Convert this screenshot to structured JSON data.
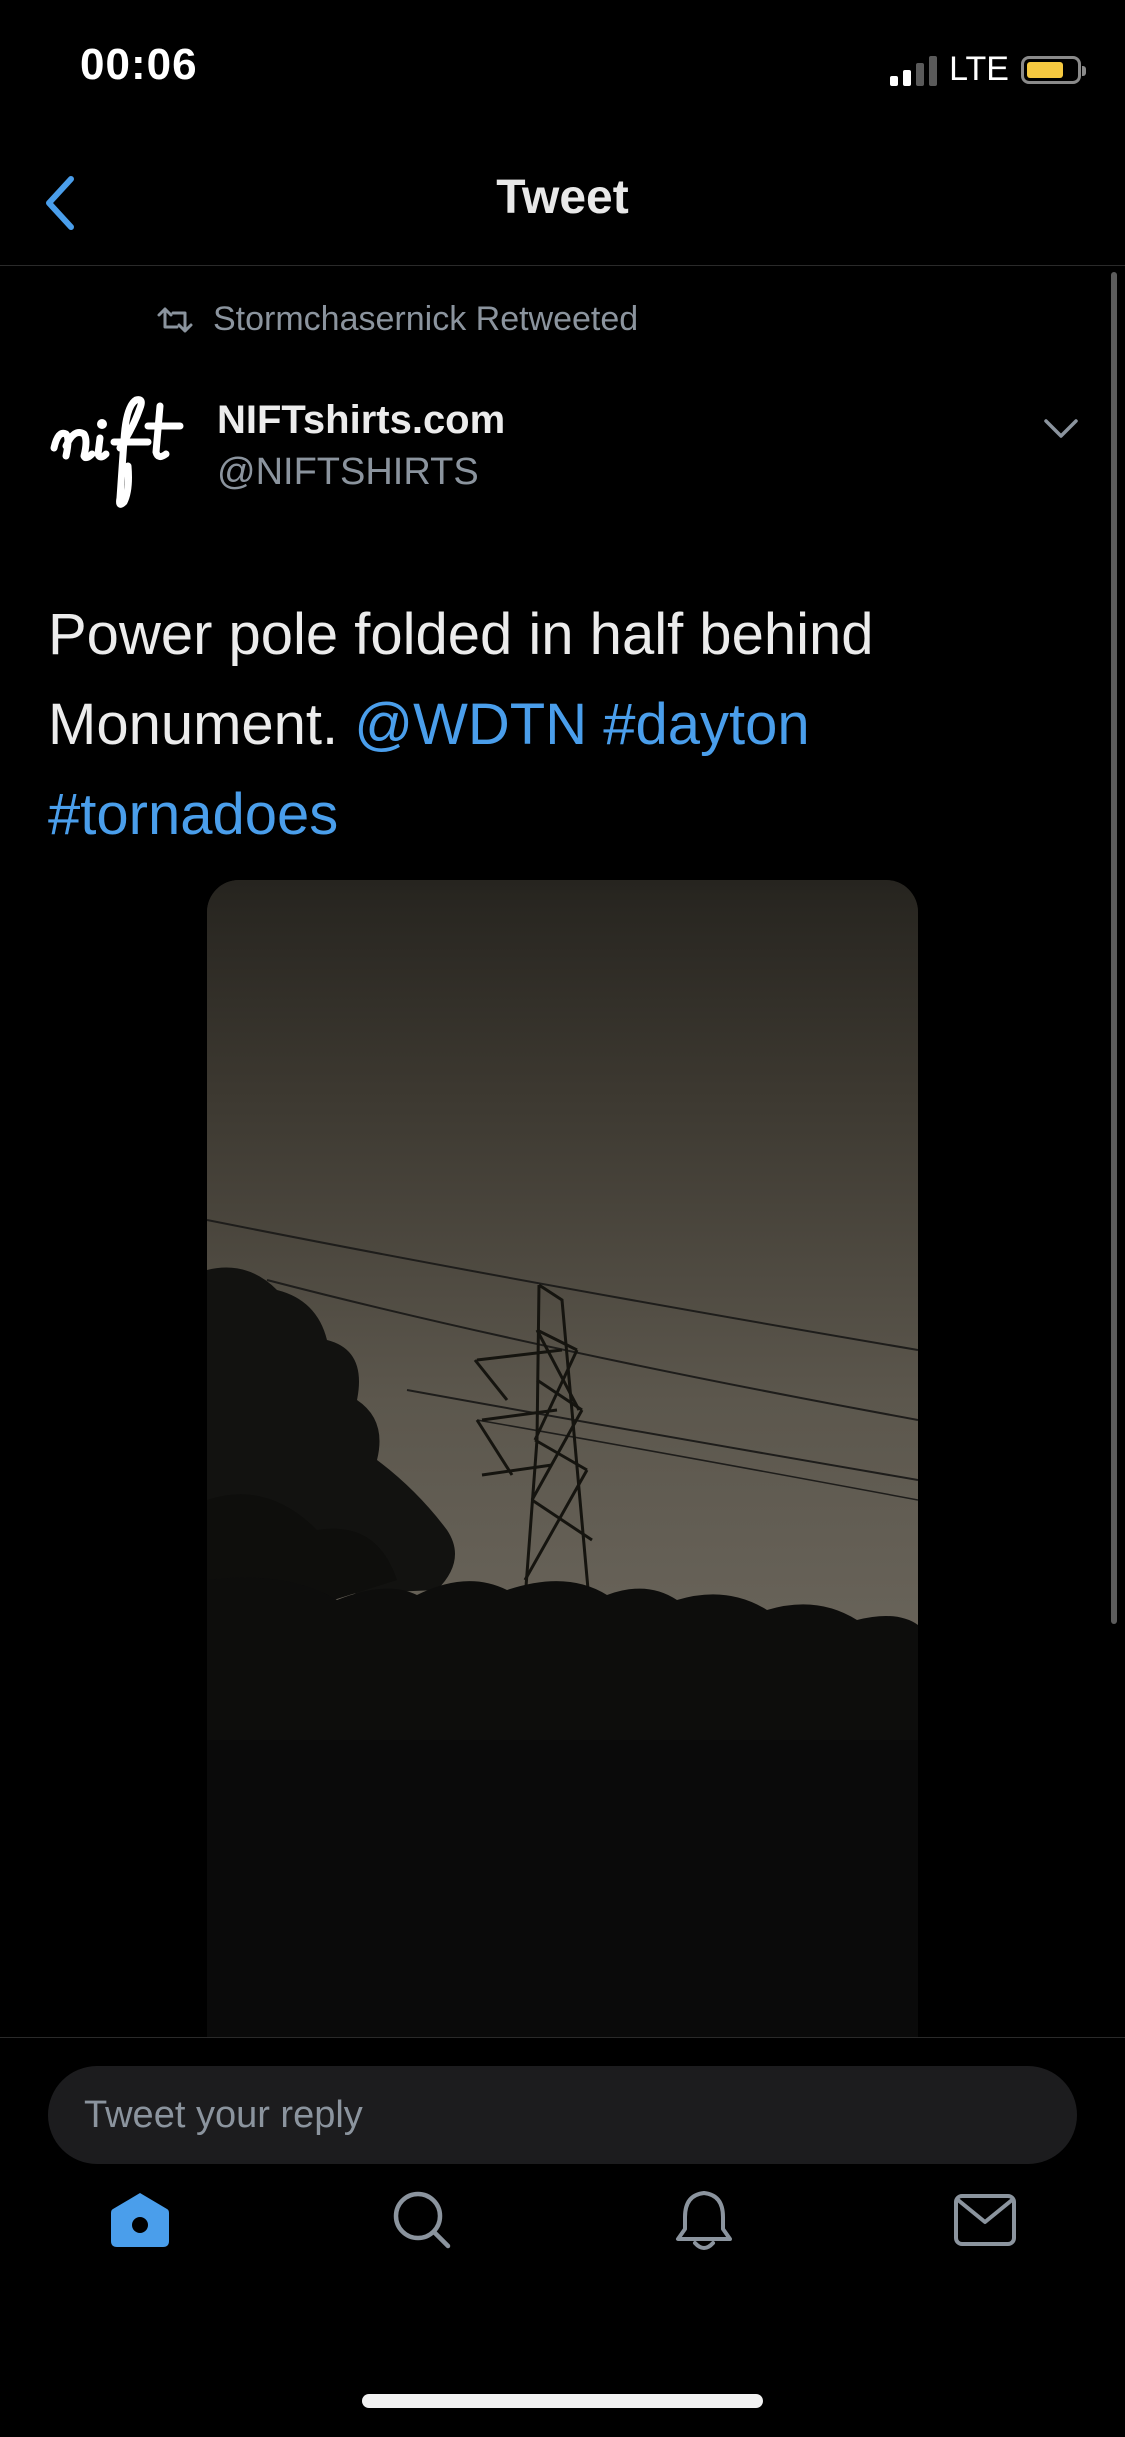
{
  "status_bar": {
    "time": "00:06",
    "network": "LTE",
    "battery_level": 0.75,
    "battery_color": "#f6c940",
    "signal_bars_active": 2,
    "signal_bars_total": 4
  },
  "nav": {
    "title": "Tweet",
    "back_icon": "chevron-left-icon"
  },
  "tweet": {
    "retweet_label": "Stormchasernick Retweeted",
    "author_name": "NIFTshirts.com",
    "author_handle": "@NIFTSHIRTS",
    "avatar_text": "nift",
    "text_plain": "Power pole folded in half behind Monument. ",
    "mention": "@WDTN",
    "hashtag_1": "#dayton",
    "hashtag_2": "#tornadoes",
    "link_color": "#4a9eeb"
  },
  "reply": {
    "placeholder": "Tweet your reply"
  },
  "tabs": [
    {
      "name": "home",
      "icon": "home-icon",
      "active": true
    },
    {
      "name": "search",
      "icon": "search-icon",
      "active": false
    },
    {
      "name": "notifications",
      "icon": "bell-icon",
      "active": false
    },
    {
      "name": "messages",
      "icon": "mail-icon",
      "active": false
    }
  ],
  "colors": {
    "accent": "#4a9eeb",
    "background": "#000000",
    "secondary_text": "#8b949e"
  }
}
